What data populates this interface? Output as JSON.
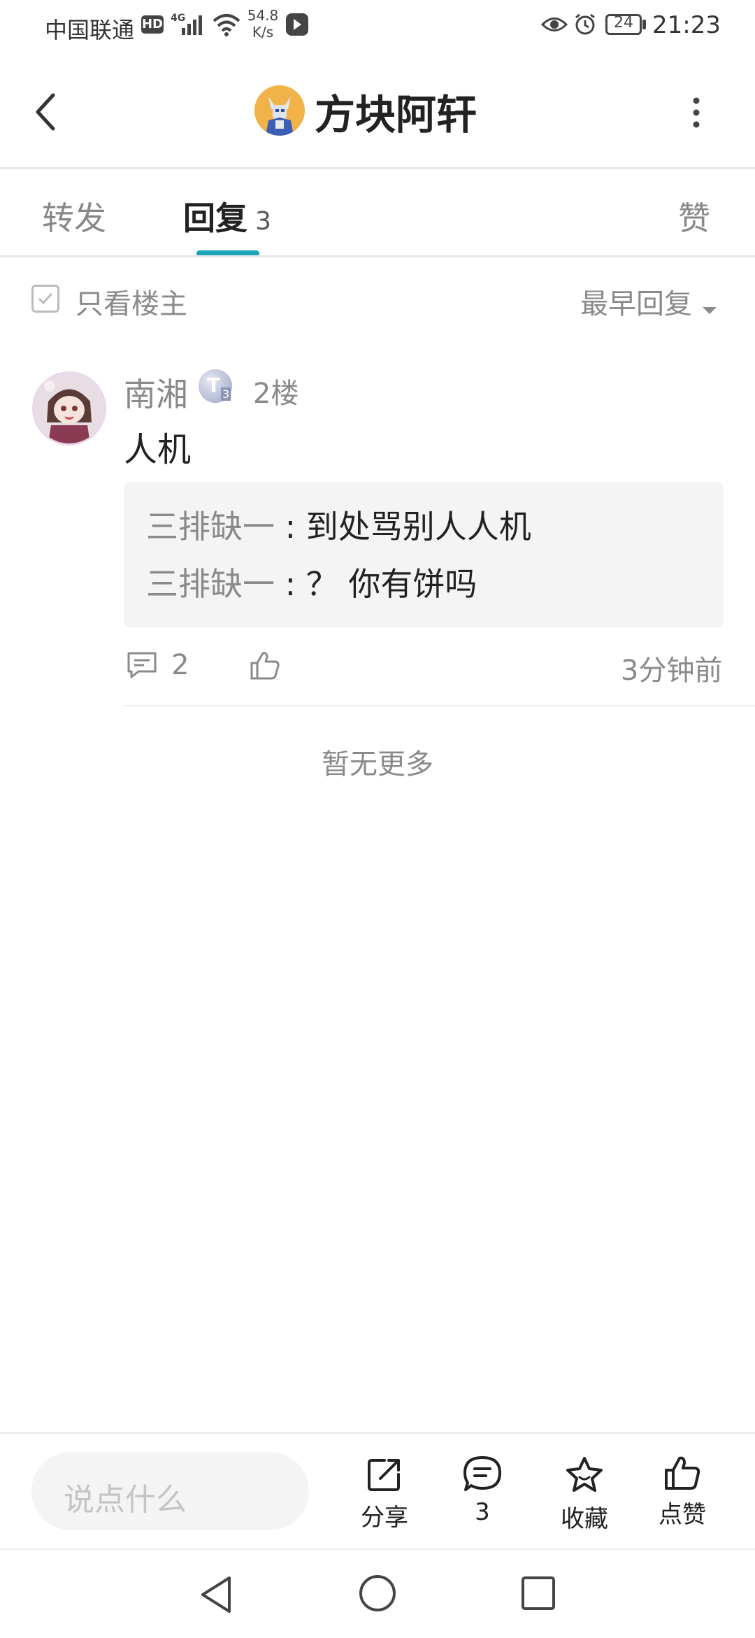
{
  "status_bar": {
    "carrier": "中国联通",
    "hd_badge": "HD",
    "network_type": "4G",
    "speed_value": "54.8",
    "speed_unit": "K/s",
    "battery": "24",
    "time": "21:23"
  },
  "header": {
    "title": "方块阿轩"
  },
  "tabs": [
    {
      "label": "转发"
    },
    {
      "label": "回复",
      "count": "3"
    },
    {
      "label": "赞"
    }
  ],
  "filter": {
    "only_op_label": "只看楼主",
    "sort_label": "最早回复"
  },
  "post": {
    "author": "南湘",
    "level_badge": "T",
    "level_sub": "3",
    "floor": "2楼",
    "content": "人机",
    "replies": [
      {
        "author": "三排缺一",
        "sep": " : ",
        "text": "到处骂别人人机"
      },
      {
        "author": "三排缺一",
        "sep": " : ",
        "text": "？ 你有饼吗"
      }
    ],
    "comment_count": "2",
    "time_ago": "3分钟前"
  },
  "no_more": "暂无更多",
  "bottom_bar": {
    "input_placeholder": "说点什么",
    "share_label": "分享",
    "comment_count": "3",
    "favorite_label": "收藏",
    "like_label": "点赞"
  },
  "colors": {
    "accent": "#1aa5b8",
    "text_primary": "#222222",
    "text_secondary": "#8a8a8a",
    "reply_box_bg": "#f4f4f5"
  }
}
